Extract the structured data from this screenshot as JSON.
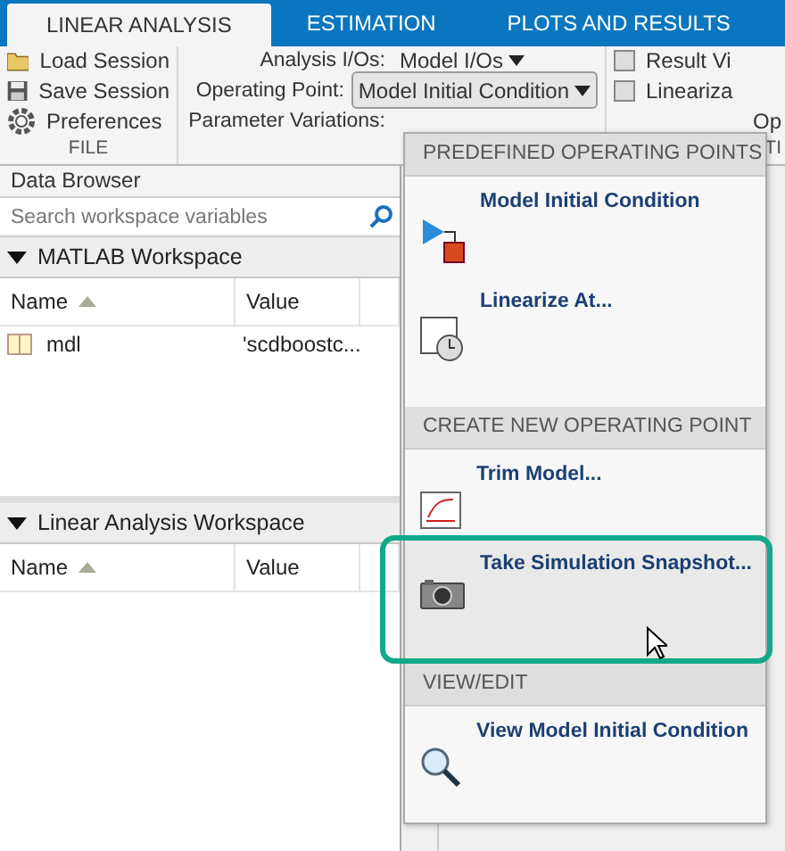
{
  "tabs": [
    {
      "label": "LINEAR ANALYSIS",
      "selected": true
    },
    {
      "label": "ESTIMATION",
      "selected": false
    },
    {
      "label": "PLOTS AND RESULTS",
      "selected": false
    }
  ],
  "file_section": {
    "buttons": [
      "Load Session",
      "Save Session",
      "Preferences"
    ],
    "label": "FILE"
  },
  "setup_section": {
    "fields": [
      {
        "label": "Analysis I/Os:",
        "value": "Model I/Os",
        "open": false
      },
      {
        "label": "Operating Point:",
        "value": "Model Initial Condition",
        "open": true
      },
      {
        "label": "Parameter Variations:"
      }
    ]
  },
  "options_section": {
    "checkboxes": [
      {
        "label": "Result Vi",
        "checked": false
      },
      {
        "label": "Lineariza",
        "checked": false
      }
    ],
    "extra": "Op",
    "label": "TI"
  },
  "data_browser": {
    "title": "Data Browser",
    "search": {
      "placeholder": "Search workspace variables"
    },
    "workspaces": [
      {
        "title": "MATLAB Workspace",
        "expanded": true,
        "columns": [
          "Name",
          "Value"
        ],
        "rows": [
          {
            "name": "mdl",
            "value": "'scdboostc..."
          }
        ]
      },
      {
        "title": "Linear Analysis Workspace",
        "expanded": true,
        "columns": [
          "Name",
          "Value"
        ]
      }
    ]
  },
  "menu": {
    "sections": [
      {
        "header": "PREDEFINED OPERATING POINTS",
        "items": [
          {
            "label": "Model Initial Condition",
            "selected": false
          },
          {
            "label": "Linearize At...",
            "selected": false
          }
        ]
      },
      {
        "header": "CREATE NEW OPERATING POINT",
        "items": [
          {
            "label": "Trim Model...",
            "selected": false
          },
          {
            "label": "Take Simulation Snapshot...",
            "selected": true
          }
        ]
      },
      {
        "header": "VIEW/EDIT",
        "items": [
          {
            "label": "View Model Initial Condition",
            "selected": false
          }
        ]
      }
    ]
  }
}
